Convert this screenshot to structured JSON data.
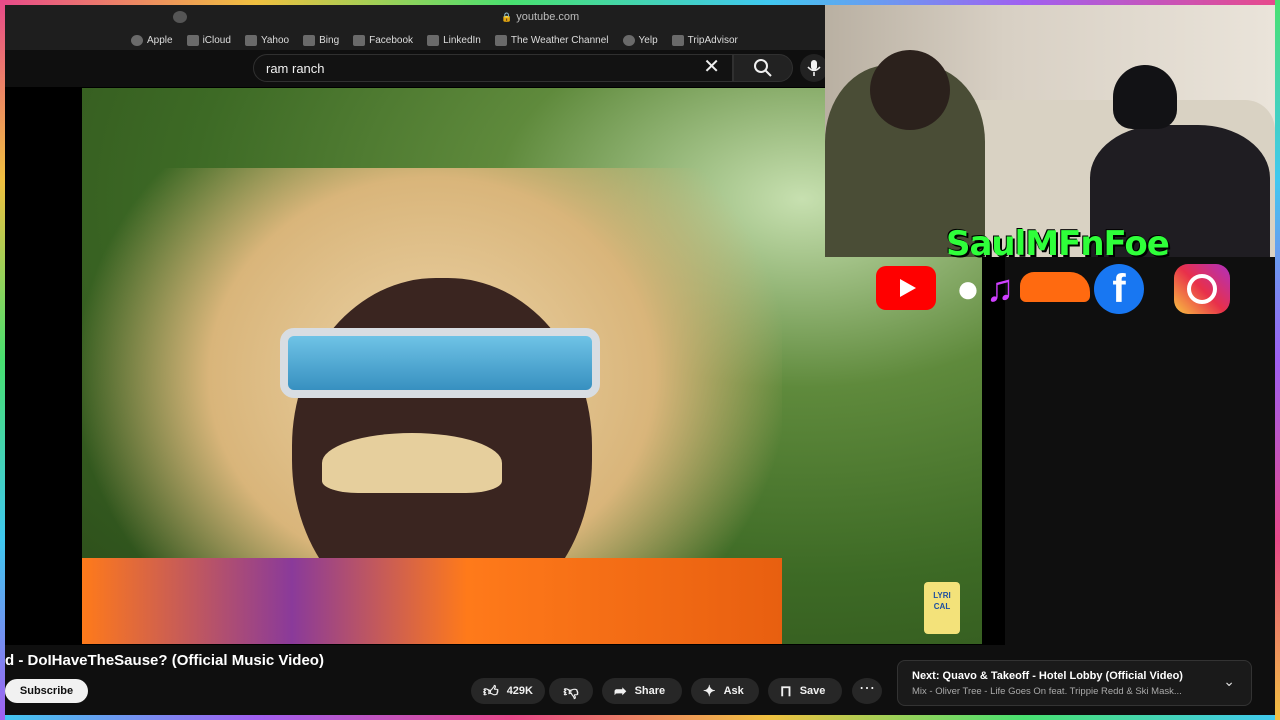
{
  "browser": {
    "url": "youtube.com",
    "bookmarks": [
      "Apple",
      "iCloud",
      "Yahoo",
      "Bing",
      "Facebook",
      "LinkedIn",
      "The Weather Channel",
      "Yelp",
      "TripAdvisor"
    ]
  },
  "search": {
    "query": "ram ranch"
  },
  "video": {
    "title": "d - DoIHaveTheSause? (Official Music Video)",
    "juice_label": "LYRI CAL"
  },
  "overlay": {
    "channel_name": "SaulMFnFoe",
    "socials": [
      "youtube-icon",
      "apple-music-icon",
      "soundcloud-icon",
      "facebook-icon",
      "instagram-icon"
    ]
  },
  "actions": {
    "subscribe": "Subscribe",
    "likes": "429K",
    "share": "Share",
    "ask": "Ask",
    "save": "Save"
  },
  "next": {
    "title": "Next: Quavo & Takeoff - Hotel Lobby (Official Video)",
    "subtitle": "Mix - Oliver Tree - Life Goes On feat. Trippie Redd & Ski Mask..."
  },
  "colors": {
    "brand_green": "#2fff3a",
    "background": "#0f0f0f"
  }
}
